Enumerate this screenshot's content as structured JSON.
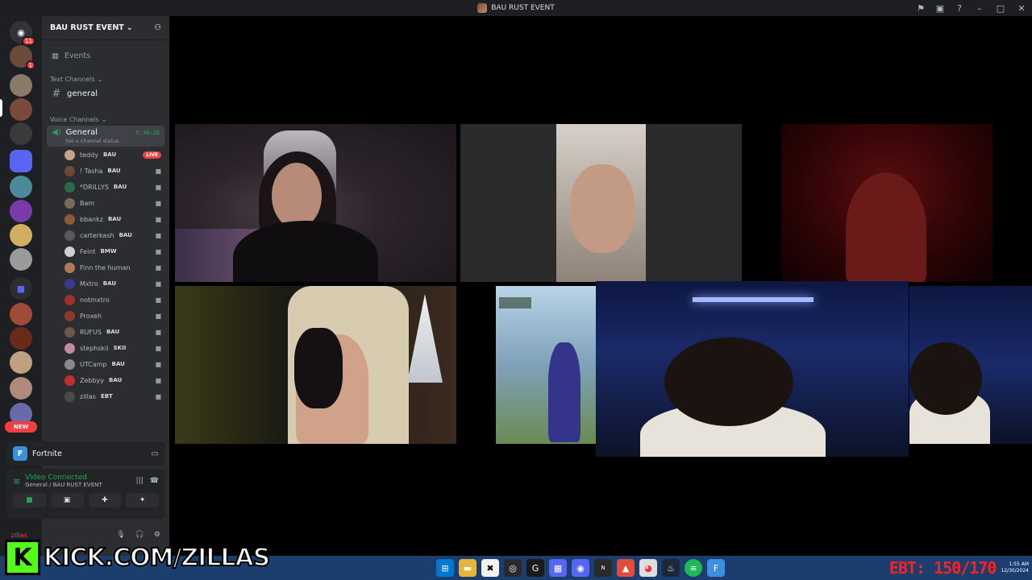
{
  "titlebar": {
    "title": "BAU RUST EVENT"
  },
  "rail": {
    "home_badge": "11",
    "dm_badge": "1",
    "new_label": "NEW"
  },
  "sidebar": {
    "server_name": "BAU RUST EVENT",
    "events_label": "Events",
    "text_category": "Text Channels",
    "text_channel": "general",
    "voice_category": "Voice Channels",
    "voice_channel": {
      "name": "General",
      "timer": "5:30:28",
      "status": "Set a channel status"
    },
    "voice_users": [
      {
        "name": "teddy",
        "tag": "BAU",
        "live": "LIVE",
        "color": "#c9a08a"
      },
      {
        "name": "! Tasha",
        "tag": "BAU",
        "color": "#6b4a3a"
      },
      {
        "name": "*DRILLYS",
        "tag": "BAU",
        "color": "#2c6a4a"
      },
      {
        "name": "Bam",
        "tag": "",
        "color": "#7a6a5a"
      },
      {
        "name": "bbankz",
        "tag": "BAU",
        "color": "#8a5a3a"
      },
      {
        "name": "carterkash",
        "tag": "BAU",
        "color": "#5a5a5a"
      },
      {
        "name": "Feint",
        "tag": "BMW",
        "color": "#d0d0d0"
      },
      {
        "name": "Finn the human",
        "tag": "",
        "color": "#b07a5a"
      },
      {
        "name": "Mxtro",
        "tag": "BAU",
        "color": "#3a3a8a"
      },
      {
        "name": "notmxtro",
        "tag": "",
        "color": "#a03030"
      },
      {
        "name": "Proxeh",
        "tag": "",
        "color": "#8a3a2a"
      },
      {
        "name": "RUFUS",
        "tag": "BAU",
        "color": "#6a5a4a"
      },
      {
        "name": "stephskii",
        "tag": "SKII",
        "color": "#c08aa0"
      },
      {
        "name": "UTCamp",
        "tag": "BAU",
        "color": "#8a8a8a"
      },
      {
        "name": "Zebbyy",
        "tag": "BAU",
        "color": "#c03030"
      },
      {
        "name": "zillas",
        "tag": "EBT",
        "color": "#4a4a4a"
      }
    ]
  },
  "activity": {
    "game": "Fortnite"
  },
  "voice_panel": {
    "title": "Video Connected",
    "subtitle": "General / BAU RUST EVENT"
  },
  "user_panel": {
    "name": "zillas"
  },
  "watermark": {
    "text": "KICK.COM/ZILLAS",
    "logo": "K"
  },
  "tray": {
    "ebt": "EBT: 150/170",
    "time": "1:55 AM",
    "date": "12/30/2024"
  },
  "colors": {
    "discord_green": "#23a55a",
    "discord_red": "#f23f43",
    "kick_green": "#53fc18"
  }
}
